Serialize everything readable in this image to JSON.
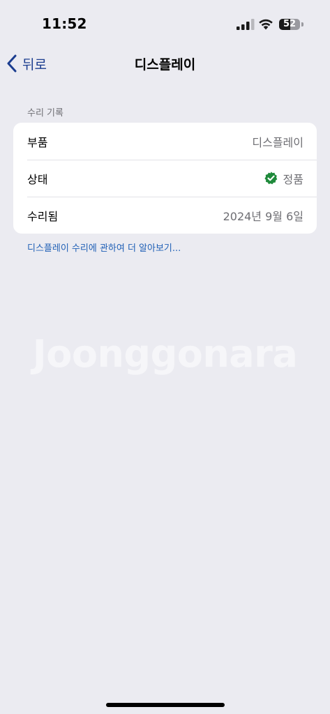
{
  "status_bar": {
    "time": "11:52",
    "battery_level": "52",
    "battery_percent": 52,
    "icons": [
      "signal-icon",
      "wifi-icon",
      "battery-icon"
    ]
  },
  "nav": {
    "back_label": "뒤로",
    "title": "디스플레이",
    "back_icon": "chevron-left-icon"
  },
  "section": {
    "header": "수리 기록",
    "rows": [
      {
        "label": "부품",
        "value": "디스플레이"
      },
      {
        "label": "상태",
        "value": "정품",
        "icon": "check-badge-icon"
      },
      {
        "label": "수리됨",
        "value": "2024년 9월 6일"
      }
    ]
  },
  "learn_more_link": "디스플레이 수리에 관하여 더 알아보기...",
  "watermark": "Joonggonara",
  "colors": {
    "background": "#ebebf1",
    "link": "#2060b6",
    "nav_accent": "#1b3d8f",
    "verified_green": "#1f8a3b",
    "secondary_text": "#6e6e73"
  }
}
